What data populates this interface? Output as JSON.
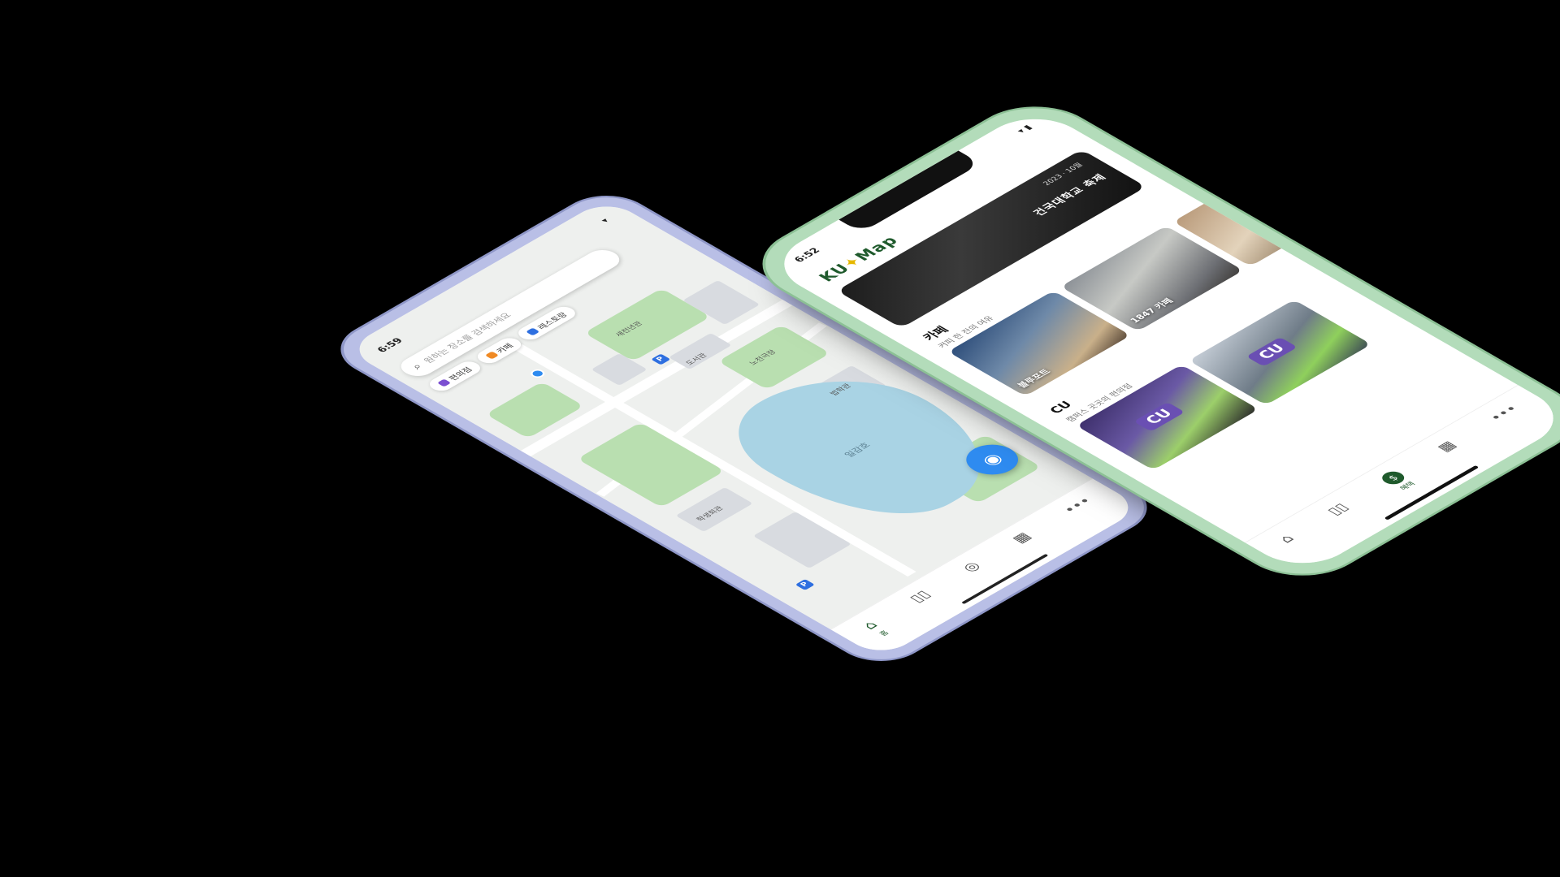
{
  "android": {
    "status_time": "6:59",
    "status_icons": "▾",
    "search_placeholder": "원하는 장소를 검색하세요",
    "search_icon": "search-icon",
    "chips": [
      {
        "label": "편의점",
        "color": "#7b4fd1"
      },
      {
        "label": "카페",
        "color": "#f08a24"
      },
      {
        "label": "레스토랑",
        "color": "#2e6fe0"
      }
    ],
    "lake_label": "일감호",
    "pois": [
      "새천년관",
      "도서관",
      "노천극장",
      "학생회관",
      "법학관"
    ],
    "parking_label": "P",
    "fab_icon": "locate-icon",
    "tabs": [
      {
        "label": "홈",
        "icon": "home-icon",
        "glyph": "⌂",
        "active": true
      },
      {
        "label": "",
        "icon": "map-icon",
        "glyph": "▯▯",
        "active": false
      },
      {
        "label": "",
        "icon": "dollar-icon",
        "glyph": "◎",
        "active": false
      },
      {
        "label": "",
        "icon": "calendar-icon",
        "glyph": "▦",
        "active": false
      },
      {
        "label": "",
        "icon": "more-icon",
        "glyph": "•••",
        "active": false
      }
    ]
  },
  "iphone": {
    "status_time": "6:52",
    "status_icons": "▾ ▮",
    "brand_left": "KU",
    "brand_star": "✦",
    "brand_right": "Map",
    "banner_small": "2023 · 10월",
    "banner_text": "건국대학교 축제",
    "sections": [
      {
        "title": "카페",
        "subtitle": "커피 한 잔의 여유",
        "cards": [
          {
            "caption": "블루포트"
          },
          {
            "caption": "1847 카페"
          },
          {
            "caption": ""
          }
        ]
      },
      {
        "title": "CU",
        "subtitle": "캠퍼스 곳곳의 편의점",
        "cards": [
          {
            "caption": "",
            "logo": "CU"
          },
          {
            "caption": "",
            "logo": "CU"
          }
        ]
      }
    ],
    "tabs": [
      {
        "label": "",
        "icon": "home-icon",
        "glyph": "⌂",
        "active": false
      },
      {
        "label": "",
        "icon": "map-icon",
        "glyph": "▯▯",
        "active": false
      },
      {
        "label": "혜택",
        "icon": "dollar-icon",
        "glyph": "$",
        "active": true
      },
      {
        "label": "",
        "icon": "calendar-icon",
        "glyph": "▦",
        "active": false
      },
      {
        "label": "",
        "icon": "more-icon",
        "glyph": "•••",
        "active": false
      }
    ]
  }
}
